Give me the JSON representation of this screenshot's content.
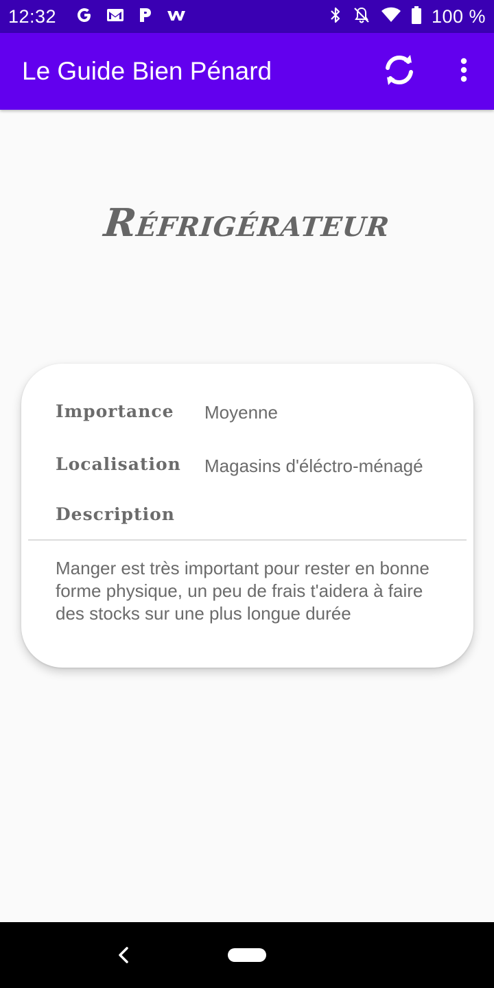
{
  "status_bar": {
    "time": "12:32",
    "notification_icons": [
      "google-icon",
      "gmail-icon",
      "pandora-icon",
      "wattpad-icon"
    ],
    "system_icons": [
      "bluetooth-icon",
      "notifications-off-icon",
      "wifi-icon",
      "battery-icon"
    ],
    "battery_text": "100 %",
    "background_color": "#3a00b3"
  },
  "app_bar": {
    "title": "Le Guide Bien Pénard",
    "actions": [
      "refresh-icon",
      "more-vert-icon"
    ],
    "background_color": "#6200ee"
  },
  "heading": "Réfrigérateur",
  "card": {
    "rows": [
      {
        "label": "Importance",
        "value": "Moyenne"
      },
      {
        "label": "Localisation",
        "value": "Magasins d'éléctro-ménagé"
      }
    ],
    "description_label": "Description",
    "description_text": "Manger est très important pour rester en bonne forme physique, un peu de frais t'aidera à faire des stocks sur une plus longue durée"
  },
  "nav_bar": {
    "buttons": [
      "back-icon",
      "home-pill"
    ]
  }
}
